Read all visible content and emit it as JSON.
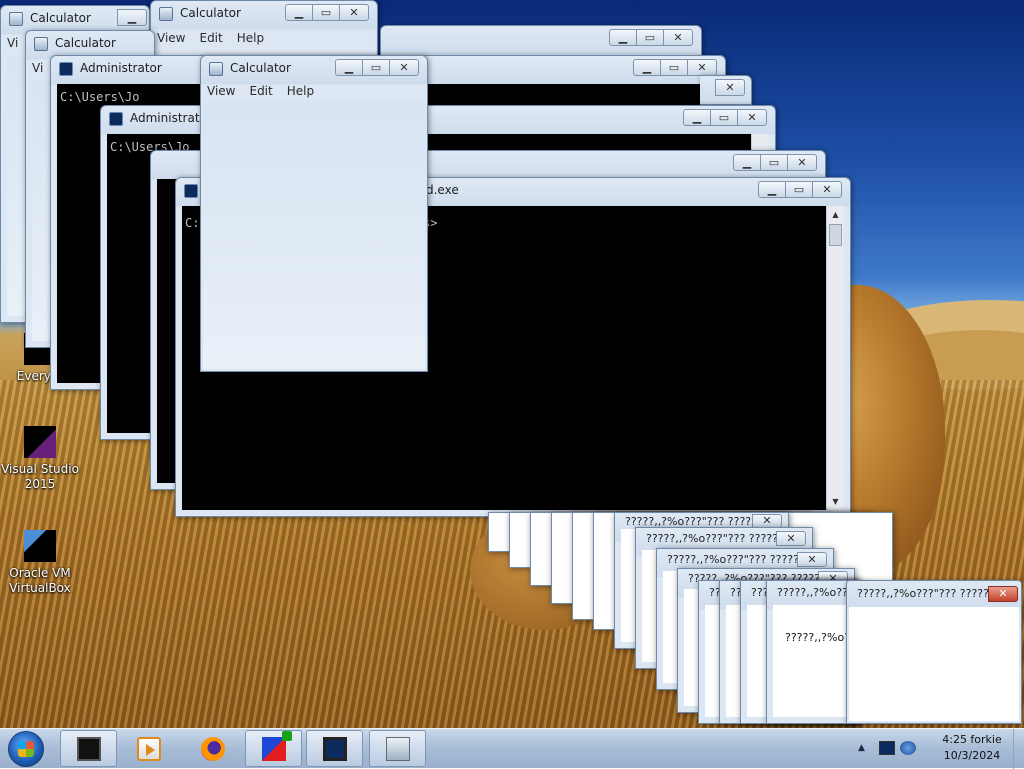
{
  "desktop": {
    "icons": [
      {
        "label": "Everyth"
      },
      {
        "label": "Visual Studio 2015"
      },
      {
        "label": "Oracle VM VirtualBox"
      }
    ]
  },
  "calculator": {
    "title": "Calculator",
    "menu": [
      "View",
      "Edit",
      "Help"
    ],
    "menu_back_partial": "Vi"
  },
  "cmd": {
    "title_admin": "Administrator",
    "title_suffix": "d.exe",
    "prompt_partial": "C:\\Users\\Jo",
    "prompt_front_left": "C:",
    "prompt_front_right": "s>"
  },
  "dialog": {
    "title": "?????,,?%o???\"??? ??????",
    "title_short": "?????,,?%o???\"??? ??????",
    "body_text": "?????,,?%o??"
  },
  "taskbar": {
    "clock_time": "4:25 forkie",
    "clock_date": "10/3/2024"
  },
  "titlebar_glyphs": {
    "minimize": "▁",
    "maximize": "▭",
    "close": "✕"
  },
  "colors": {
    "console_bg": "#000000",
    "console_fg": "#c0c0c0",
    "close_red": "#c4412b"
  }
}
